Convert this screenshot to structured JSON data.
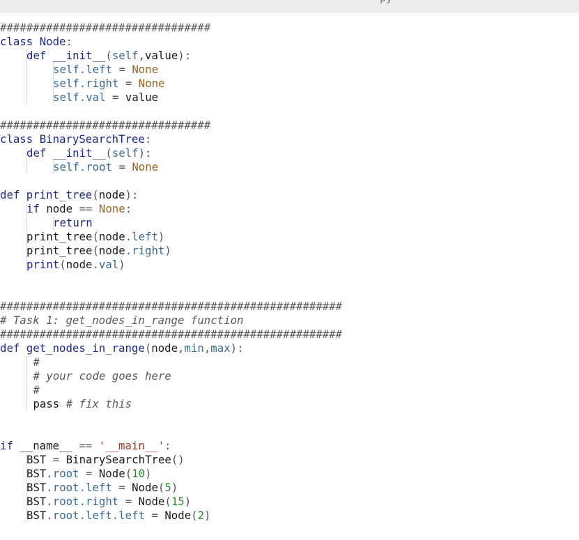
{
  "window": {
    "title_fragment": "py"
  },
  "code": {
    "language": "python",
    "lines": [
      {
        "indent": 0,
        "tokens": [
          [
            "c",
            "################################"
          ]
        ]
      },
      {
        "indent": 0,
        "tokens": [
          [
            "k",
            "class"
          ],
          [
            "t",
            " "
          ],
          [
            "cl",
            "Node"
          ],
          [
            "p",
            ":"
          ]
        ]
      },
      {
        "indent": 1,
        "tokens": [
          [
            "k",
            "def"
          ],
          [
            "t",
            " "
          ],
          [
            "f",
            "__init__"
          ],
          [
            "p",
            "("
          ],
          [
            "s",
            "self"
          ],
          [
            "p",
            ","
          ],
          [
            "t",
            "value"
          ],
          [
            "p",
            "):"
          ]
        ]
      },
      {
        "indent": 2,
        "tokens": [
          [
            "s",
            "self"
          ],
          [
            "a",
            ".left"
          ],
          [
            "p",
            " = "
          ],
          [
            "n",
            "None"
          ]
        ]
      },
      {
        "indent": 2,
        "tokens": [
          [
            "s",
            "self"
          ],
          [
            "a",
            ".right"
          ],
          [
            "p",
            " = "
          ],
          [
            "n",
            "None"
          ]
        ]
      },
      {
        "indent": 2,
        "tokens": [
          [
            "s",
            "self"
          ],
          [
            "a",
            ".val"
          ],
          [
            "p",
            " = "
          ],
          [
            "t",
            "value"
          ]
        ]
      },
      {
        "indent": 0,
        "tokens": []
      },
      {
        "indent": 0,
        "tokens": [
          [
            "c",
            "################################"
          ]
        ]
      },
      {
        "indent": 0,
        "tokens": [
          [
            "k",
            "class"
          ],
          [
            "t",
            " "
          ],
          [
            "cl",
            "BinarySearchTree"
          ],
          [
            "p",
            ":"
          ]
        ]
      },
      {
        "indent": 1,
        "tokens": [
          [
            "k",
            "def"
          ],
          [
            "t",
            " "
          ],
          [
            "f",
            "__init__"
          ],
          [
            "p",
            "("
          ],
          [
            "s",
            "self"
          ],
          [
            "p",
            "):"
          ]
        ]
      },
      {
        "indent": 2,
        "tokens": [
          [
            "s",
            "self"
          ],
          [
            "a",
            ".root"
          ],
          [
            "p",
            " = "
          ],
          [
            "n",
            "None"
          ]
        ]
      },
      {
        "indent": 0,
        "tokens": []
      },
      {
        "indent": 0,
        "tokens": [
          [
            "k",
            "def"
          ],
          [
            "t",
            " "
          ],
          [
            "f",
            "print_tree"
          ],
          [
            "p",
            "("
          ],
          [
            "t",
            "node"
          ],
          [
            "p",
            "):"
          ]
        ]
      },
      {
        "indent": 1,
        "tokens": [
          [
            "k",
            "if"
          ],
          [
            "t",
            " node "
          ],
          [
            "p",
            "=="
          ],
          [
            "t",
            " "
          ],
          [
            "n",
            "None"
          ],
          [
            "p",
            ":"
          ]
        ]
      },
      {
        "indent": 2,
        "tokens": [
          [
            "k",
            "return"
          ]
        ]
      },
      {
        "indent": 1,
        "tokens": [
          [
            "t",
            "print_tree"
          ],
          [
            "p",
            "("
          ],
          [
            "t",
            "node"
          ],
          [
            "a",
            ".left"
          ],
          [
            "p",
            ")"
          ]
        ]
      },
      {
        "indent": 1,
        "tokens": [
          [
            "t",
            "print_tree"
          ],
          [
            "p",
            "("
          ],
          [
            "t",
            "node"
          ],
          [
            "a",
            ".right"
          ],
          [
            "p",
            ")"
          ]
        ]
      },
      {
        "indent": 1,
        "tokens": [
          [
            "f",
            "print"
          ],
          [
            "p",
            "("
          ],
          [
            "t",
            "node"
          ],
          [
            "a",
            ".val"
          ],
          [
            "p",
            ")"
          ]
        ]
      },
      {
        "indent": 0,
        "tokens": []
      },
      {
        "indent": 0,
        "tokens": []
      },
      {
        "indent": 0,
        "tokens": [
          [
            "c",
            "####################################################"
          ]
        ]
      },
      {
        "indent": 0,
        "tokens": [
          [
            "c",
            "# Task 1: get_nodes_in_range function"
          ]
        ]
      },
      {
        "indent": 0,
        "tokens": [
          [
            "c",
            "####################################################"
          ]
        ]
      },
      {
        "indent": 0,
        "tokens": [
          [
            "k",
            "def"
          ],
          [
            "t",
            " "
          ],
          [
            "f",
            "get_nodes_in_range"
          ],
          [
            "p",
            "("
          ],
          [
            "t",
            "node"
          ],
          [
            "p",
            ","
          ],
          [
            "a",
            "min"
          ],
          [
            "p",
            ","
          ],
          [
            "a",
            "max"
          ],
          [
            "p",
            "):"
          ]
        ]
      },
      {
        "indent": 1,
        "tokens": [
          [
            "t",
            " "
          ],
          [
            "c",
            "#"
          ]
        ]
      },
      {
        "indent": 1,
        "tokens": [
          [
            "t",
            " "
          ],
          [
            "c",
            "# your code goes here"
          ]
        ]
      },
      {
        "indent": 1,
        "tokens": [
          [
            "t",
            " "
          ],
          [
            "c",
            "#"
          ]
        ]
      },
      {
        "indent": 1,
        "tokens": [
          [
            "t",
            " pass "
          ],
          [
            "c",
            "# fix this"
          ]
        ]
      },
      {
        "indent": 0,
        "tokens": []
      },
      {
        "indent": 0,
        "tokens": []
      },
      {
        "indent": 0,
        "tokens": [
          [
            "k",
            "if"
          ],
          [
            "t",
            " __name__ "
          ],
          [
            "p",
            "=="
          ],
          [
            "t",
            " "
          ],
          [
            "r",
            "'__main__'"
          ],
          [
            "p",
            ":"
          ]
        ]
      },
      {
        "indent": 1,
        "tokens": [
          [
            "t",
            "BST "
          ],
          [
            "p",
            "="
          ],
          [
            "t",
            " BinarySearchTree"
          ],
          [
            "p",
            "()"
          ]
        ]
      },
      {
        "indent": 1,
        "tokens": [
          [
            "t",
            "BST"
          ],
          [
            "a",
            ".root"
          ],
          [
            "p",
            " = "
          ],
          [
            "t",
            "Node"
          ],
          [
            "p",
            "("
          ],
          [
            "m",
            "10"
          ],
          [
            "p",
            ")"
          ]
        ]
      },
      {
        "indent": 1,
        "tokens": [
          [
            "t",
            "BST"
          ],
          [
            "a",
            ".root.left"
          ],
          [
            "p",
            " = "
          ],
          [
            "t",
            "Node"
          ],
          [
            "p",
            "("
          ],
          [
            "m",
            "5"
          ],
          [
            "p",
            ")"
          ]
        ]
      },
      {
        "indent": 1,
        "tokens": [
          [
            "t",
            "BST"
          ],
          [
            "a",
            ".root.right"
          ],
          [
            "p",
            " = "
          ],
          [
            "t",
            "Node"
          ],
          [
            "p",
            "("
          ],
          [
            "m",
            "15"
          ],
          [
            "p",
            ")"
          ]
        ]
      },
      {
        "indent": 1,
        "tokens": [
          [
            "t",
            "BST"
          ],
          [
            "a",
            ".root.left.left"
          ],
          [
            "p",
            " = "
          ],
          [
            "t",
            "Node"
          ],
          [
            "p",
            "("
          ],
          [
            "m",
            "2"
          ],
          [
            "p",
            ")"
          ]
        ]
      }
    ]
  },
  "colors": {
    "keyword": "#1b2a8c",
    "self": "#3a6b92",
    "constant": "#9a6322",
    "number": "#2d8a2d",
    "string": "#a53a2b",
    "comment": "#5a5a5a"
  }
}
